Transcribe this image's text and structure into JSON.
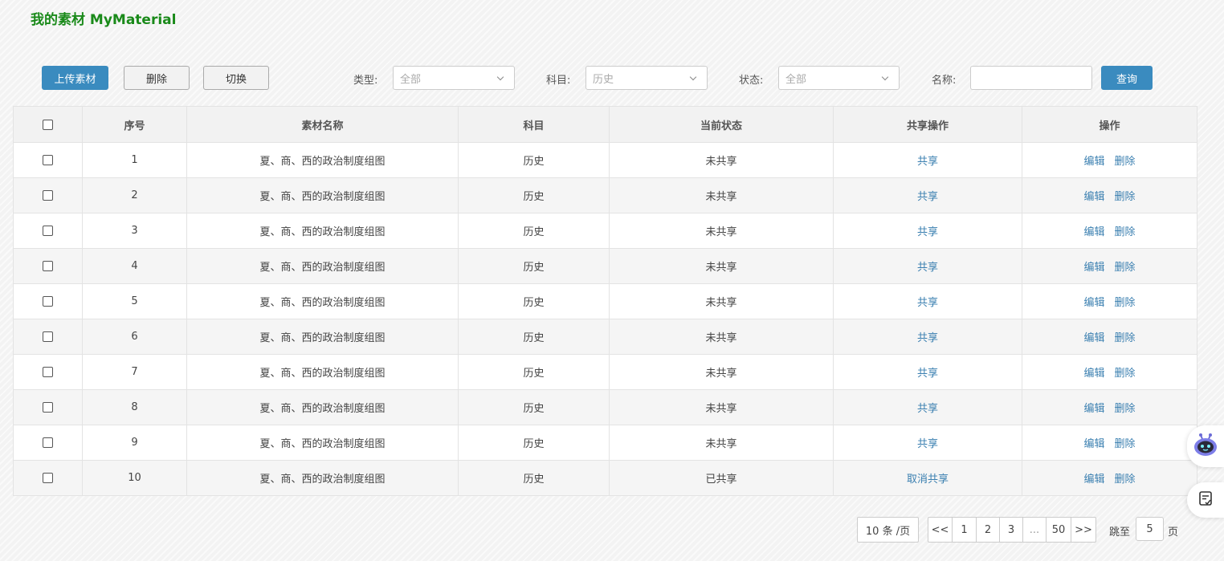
{
  "page": {
    "title": "我的素材 MyMaterial"
  },
  "toolbar": {
    "upload_label": "上传素材",
    "delete_label": "删除",
    "switch_label": "切换",
    "type_label": "类型:",
    "type_value": "全部",
    "subject_label": "科目:",
    "subject_value": "历史",
    "status_label": "状态:",
    "status_value": "全部",
    "name_label": "名称:",
    "name_value": "",
    "query_label": "查询"
  },
  "table": {
    "headers": [
      "序号",
      "素材名称",
      "科目",
      "当前状态",
      "共享操作",
      "操作"
    ],
    "edit_label": "编辑",
    "delete_label": "删除",
    "rows": [
      {
        "no": "1",
        "name": "夏、商、西的政治制度组图",
        "subject": "历史",
        "status": "未共享",
        "share_action": "共享"
      },
      {
        "no": "2",
        "name": "夏、商、西的政治制度组图",
        "subject": "历史",
        "status": "未共享",
        "share_action": "共享"
      },
      {
        "no": "3",
        "name": "夏、商、西的政治制度组图",
        "subject": "历史",
        "status": "未共享",
        "share_action": "共享"
      },
      {
        "no": "4",
        "name": "夏、商、西的政治制度组图",
        "subject": "历史",
        "status": "未共享",
        "share_action": "共享"
      },
      {
        "no": "5",
        "name": "夏、商、西的政治制度组图",
        "subject": "历史",
        "status": "未共享",
        "share_action": "共享"
      },
      {
        "no": "6",
        "name": "夏、商、西的政治制度组图",
        "subject": "历史",
        "status": "未共享",
        "share_action": "共享"
      },
      {
        "no": "7",
        "name": "夏、商、西的政治制度组图",
        "subject": "历史",
        "status": "未共享",
        "share_action": "共享"
      },
      {
        "no": "8",
        "name": "夏、商、西的政治制度组图",
        "subject": "历史",
        "status": "未共享",
        "share_action": "共享"
      },
      {
        "no": "9",
        "name": "夏、商、西的政治制度组图",
        "subject": "历史",
        "status": "未共享",
        "share_action": "共享"
      },
      {
        "no": "10",
        "name": "夏、商、西的政治制度组图",
        "subject": "历史",
        "status": "已共享",
        "share_action": "取消共享"
      }
    ]
  },
  "pagination": {
    "page_size": "10 条 /页",
    "pages": [
      "<<",
      "1",
      "2",
      "3",
      "...",
      "50",
      ">>"
    ],
    "jump_prefix": "跳至",
    "jump_value": "5",
    "jump_suffix": "页"
  },
  "widgets": {
    "assistant_icon": "robot-assistant-icon",
    "notes_icon": "note-checklist-icon"
  }
}
